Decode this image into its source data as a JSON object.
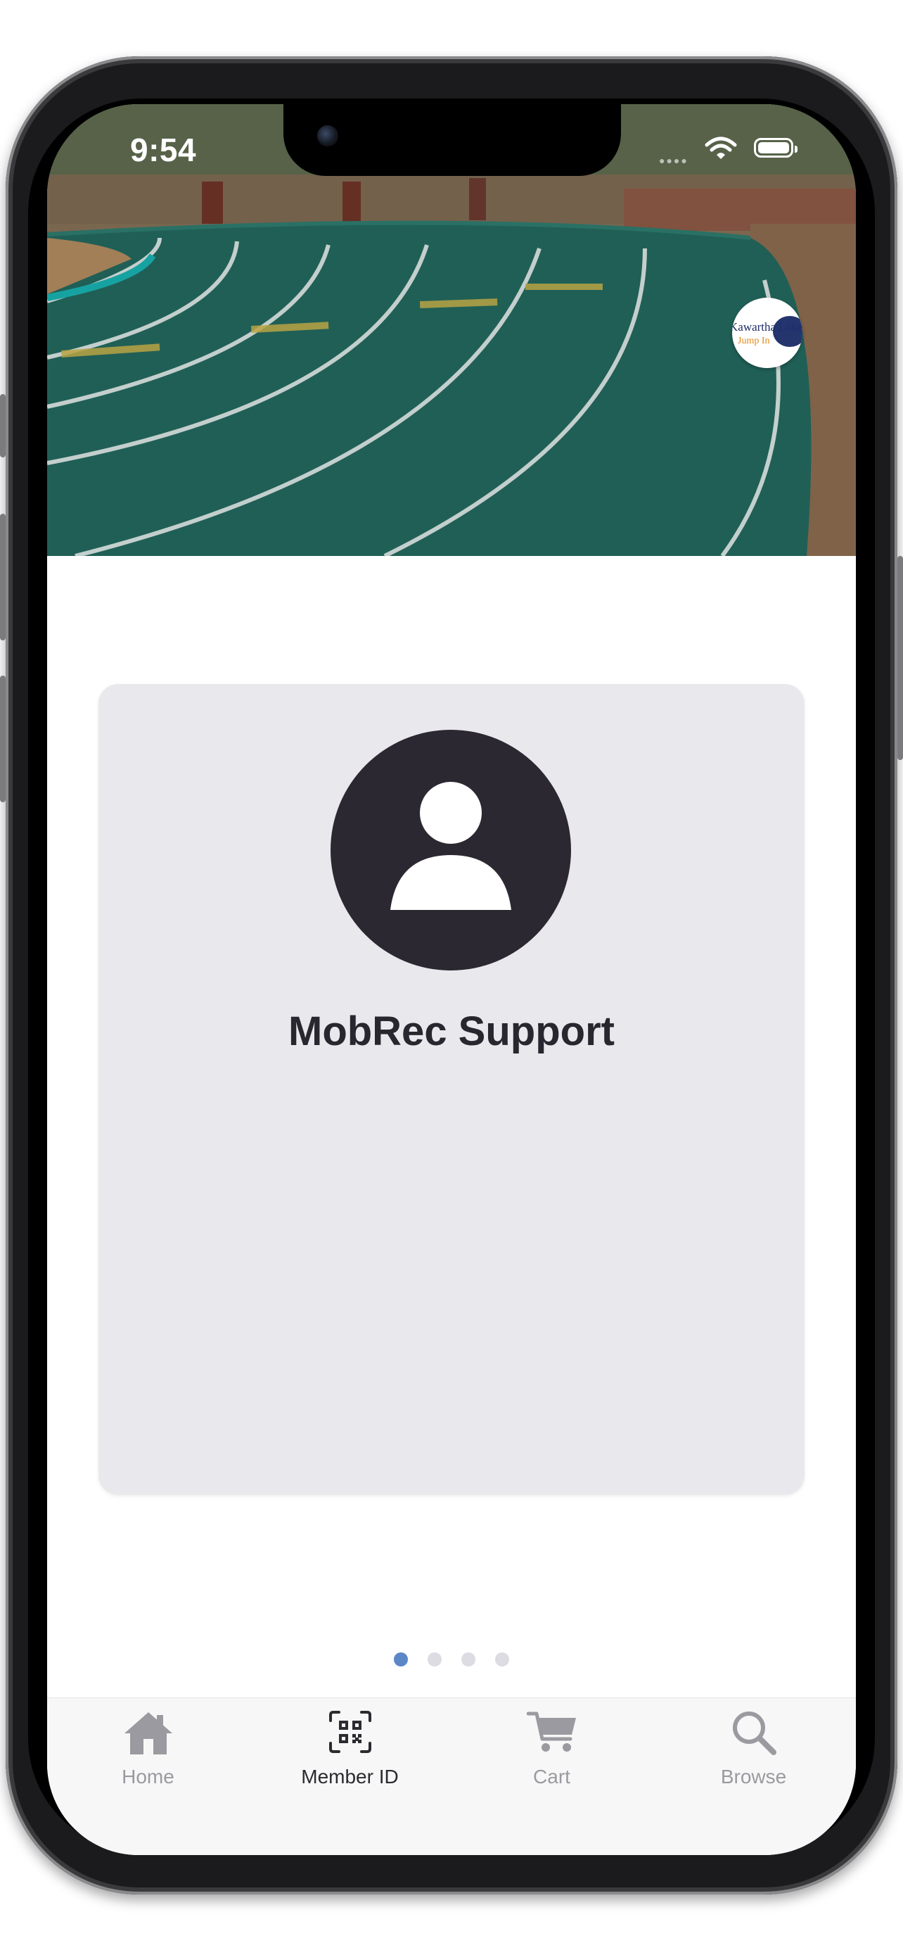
{
  "status_bar": {
    "time": "9:54"
  },
  "header": {
    "logo_text_top": "Kawartha Lakes",
    "logo_text_bottom": "Jump In"
  },
  "member_card": {
    "name": "MobRec Support"
  },
  "pager": {
    "count": 4,
    "active_index": 0
  },
  "tab_bar": {
    "items": [
      {
        "label": "Home",
        "icon": "home-icon",
        "active": false
      },
      {
        "label": "Member ID",
        "icon": "qr-code-icon",
        "active": true
      },
      {
        "label": "Cart",
        "icon": "cart-icon",
        "active": false
      },
      {
        "label": "Browse",
        "icon": "search-icon",
        "active": false
      }
    ]
  },
  "colors": {
    "accent": "#5b87c7",
    "card_bg": "#e9e9ed",
    "avatar_bg": "#2b2832",
    "tab_inactive": "#9a9aa0",
    "tab_active": "#2b2b30"
  }
}
